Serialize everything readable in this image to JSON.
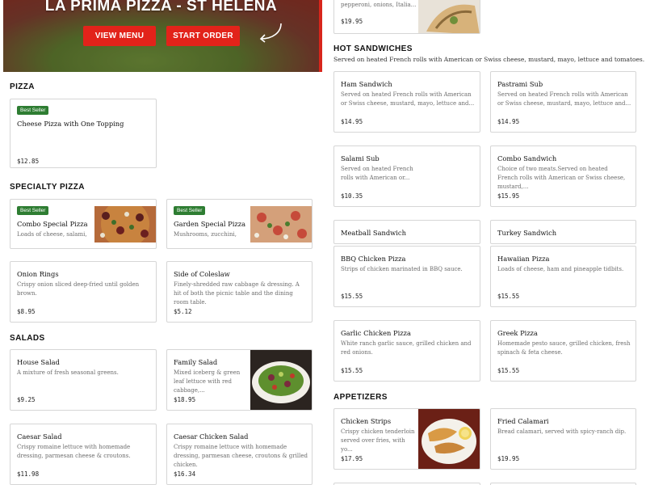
{
  "hero": {
    "title": "LA PRIMA PIZZA - ST HELENA",
    "view_menu_label": "VIEW MENU",
    "start_order_label": "START ORDER"
  },
  "top_right_card": {
    "desc": "pepperoni, onions, Italia...",
    "price": "$19.95"
  },
  "hot_sandwiches": {
    "title": "HOT SANDWICHES",
    "desc": "Served on heated French rolls with American or Swiss cheese, mustard, mayo, lettuce and tomatoes.",
    "items": [
      {
        "name": "Ham Sandwich",
        "desc": "Served on heated French rolls with American or Swiss cheese, mustard, mayo, lettuce and...",
        "price": "$14.95"
      },
      {
        "name": "Pastrami Sub",
        "desc": "Served on heated French rolls with American or Swiss cheese, mustard, mayo, lettuce and...",
        "price": "$14.95"
      },
      {
        "name": "Salami Sub",
        "desc": "Served on heated French rolls with American or...",
        "price": "$10.35"
      },
      {
        "name": "Combo Sandwich",
        "desc": "Choice of two meats.Served on heated French rolls with American or Swiss cheese, mustard,...",
        "price": "$15.95"
      },
      {
        "name": "Meatball Sandwich",
        "desc": "",
        "price": ""
      },
      {
        "name": "Turkey Sandwich",
        "desc": "",
        "price": ""
      }
    ]
  },
  "pizza": {
    "title": "PIZZA",
    "items": [
      {
        "badge": "Best Seller",
        "name": "Cheese Pizza with One Topping",
        "price": "$12.85"
      }
    ]
  },
  "specialty_pizza": {
    "title": "SPECIALTY PIZZA",
    "items": [
      {
        "badge": "Best Seller",
        "name": "Combo Special Pizza",
        "desc": "Loads of cheese, salami,"
      },
      {
        "badge": "Best Seller",
        "name": "Garden Special Pizza",
        "desc": "Mushrooms, zucchini,"
      },
      {
        "name": "BBQ Chicken Pizza",
        "desc": "Strips of chicken marinated in BBQ sauce.",
        "price": "$15.55"
      },
      {
        "name": "Hawaiian Pizza",
        "desc": "Loads of cheese, ham and pineapple tidbits.",
        "price": "$15.55"
      },
      {
        "name": "Garlic Chicken Pizza",
        "desc": "White ranch garlic sauce, grilled chicken and red onions.",
        "price": "$15.55"
      },
      {
        "name": "Greek Pizza",
        "desc": "Homemade pesto sauce, grilled chicken, fresh spinach & feta cheese.",
        "price": "$15.55"
      }
    ]
  },
  "sides": {
    "items": [
      {
        "name": "Onion Rings",
        "desc": "Crispy onion sliced deep-fried until golden brown.",
        "price": "$8.95"
      },
      {
        "name": "Side of Coleslaw",
        "desc": "Finely-shredded raw cabbage & dressing. A hit of both the picnic table and the dining room table.",
        "price": "$5.12"
      }
    ]
  },
  "salads": {
    "title": "SALADS",
    "items": [
      {
        "name": "House Salad",
        "desc": "A mixture of fresh seasonal greens.",
        "price": "$9.25"
      },
      {
        "name": "Family Salad",
        "desc": "Mixed iceberg & green leaf lettuce with red cabbage,...",
        "price": "$18.95"
      },
      {
        "name": "Caesar Salad",
        "desc": "Crispy romaine lettuce with homemade dressing, parmesan cheese & croutons.",
        "price": "$11.98"
      },
      {
        "name": "Caesar Chicken Salad",
        "desc": "Crispy romaine lettuce with homemade dressing, parmesan cheese, croutons & grilled chicken.",
        "price": "$16.34"
      }
    ]
  },
  "appetizers": {
    "title": "APPETIZERS",
    "items": [
      {
        "name": "Chicken Strips",
        "desc": "Crispy chicken tenderloin served over fries, with yo...",
        "price": "$17.95"
      },
      {
        "name": "Fried Calamari",
        "desc": "Bread calamari, served with spicy-ranch dip.",
        "price": "$19.95"
      }
    ]
  },
  "colors": {
    "brand_red": "#e2231a",
    "badge_green": "#2e7d32"
  }
}
